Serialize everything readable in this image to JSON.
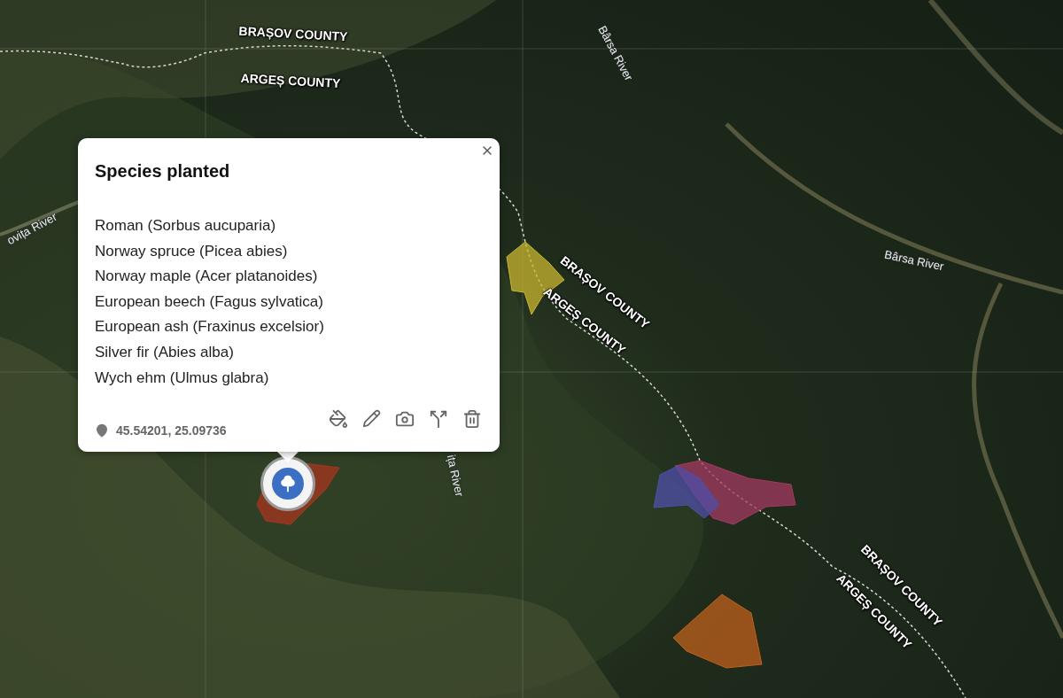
{
  "map": {
    "labels": [
      {
        "text": "BRAȘOV COUNTY",
        "kind": "county"
      },
      {
        "text": "ARGEȘ COUNTY",
        "kind": "county"
      },
      {
        "text": "Bârsa River",
        "kind": "river"
      },
      {
        "text": "ovița River",
        "kind": "river"
      },
      {
        "text": "BRAȘOV COUNTY",
        "kind": "county"
      },
      {
        "text": "ARGEȘ COUNTY",
        "kind": "county"
      },
      {
        "text": "Bârsa River",
        "kind": "river"
      },
      {
        "text": "ița River",
        "kind": "river"
      },
      {
        "text": "BRAȘOV COUNTY",
        "kind": "county"
      },
      {
        "text": "ARGEȘ COUNTY",
        "kind": "county"
      }
    ],
    "areas": [
      {
        "color": "#c8b630"
      },
      {
        "color": "#a8341f"
      },
      {
        "color": "#a33a60"
      },
      {
        "color": "#4f4fa8"
      },
      {
        "color": "#c0601c"
      }
    ]
  },
  "popup": {
    "title": "Species planted",
    "species": [
      "Roman (Sorbus aucuparia)",
      "Norway spruce (Picea abies)",
      "Norway maple (Acer platanoides)",
      "European beech (Fagus sylvatica)",
      "European ash (Fraxinus excelsior)",
      "Silver fir (Abies alba)",
      "Wych ehm (Ulmus glabra)"
    ],
    "coordinates": "45.54201, 25.09736"
  }
}
